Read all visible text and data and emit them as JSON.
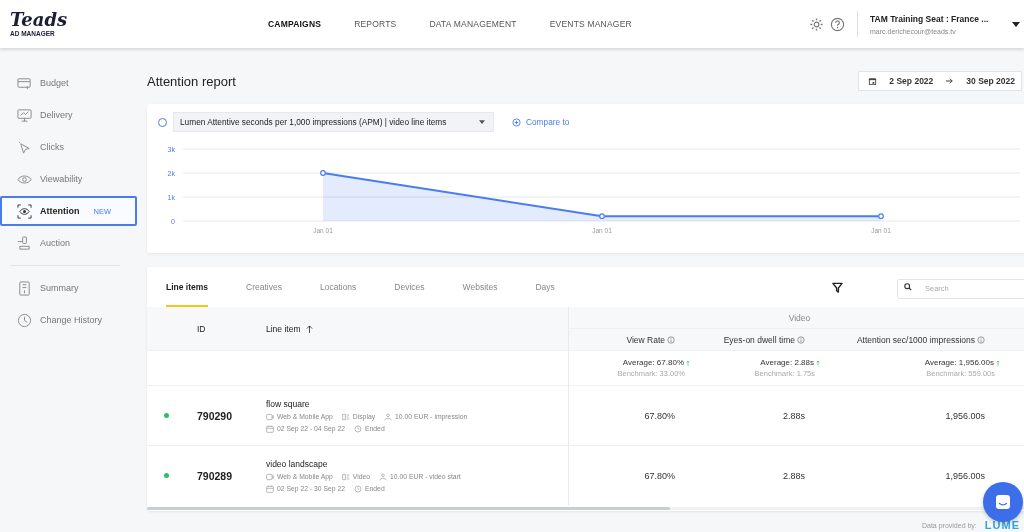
{
  "header": {
    "logo": "Teads",
    "logo_sub": "AD MANAGER",
    "nav": [
      {
        "label": "CAMPAIGNS",
        "selected": true
      },
      {
        "label": "REPORTS",
        "selected": false
      },
      {
        "label": "DATA MANAGEMENT",
        "selected": false
      },
      {
        "label": "EVENTS MANAGER",
        "selected": false
      }
    ],
    "account": {
      "name": "TAM Training Seat : France ...",
      "email": "marc.derichecour@teads.tv"
    }
  },
  "sidebar": {
    "items": [
      {
        "label": "Budget",
        "selected": false
      },
      {
        "label": "Delivery",
        "selected": false
      },
      {
        "label": "Clicks",
        "selected": false
      },
      {
        "label": "Viewability",
        "selected": false
      },
      {
        "label": "Attention",
        "badge": "NEW",
        "selected": true
      },
      {
        "label": "Auction",
        "selected": false
      }
    ],
    "secondary": [
      {
        "label": "Summary",
        "selected": false
      },
      {
        "label": "Change History",
        "selected": false
      }
    ]
  },
  "page": {
    "title": "Attention report",
    "date_from": "2 Sep 2022",
    "date_to": "30 Sep 2022"
  },
  "chart": {
    "series_selected": true,
    "metric": "Lumen Attentive seconds per 1,000 impressions (APM) | video line items",
    "compare": "Compare to",
    "chart_data": {
      "type": "area",
      "categories": [
        "Jan 01",
        "Jan 01",
        "Jan 01"
      ],
      "series": [
        {
          "color": "#4a7cf0",
          "values": [
            2000,
            200,
            200
          ]
        }
      ],
      "ylim": [
        0,
        3000
      ],
      "yticks": [
        {
          "value": 0,
          "label": "0"
        },
        {
          "value": 1000,
          "label": "1k"
        },
        {
          "value": 2000,
          "label": "2k"
        },
        {
          "value": 3000,
          "label": "3k"
        }
      ]
    }
  },
  "tabs": [
    {
      "label": "Line items",
      "selected": true
    },
    {
      "label": "Creatives",
      "selected": false
    },
    {
      "label": "Locations",
      "selected": false
    },
    {
      "label": "Devices",
      "selected": false
    },
    {
      "label": "Websites",
      "selected": false
    },
    {
      "label": "Days",
      "selected": false
    }
  ],
  "search": {
    "placeholder": "Search"
  },
  "table": {
    "group": "Video",
    "columns": [
      "ID",
      "Line item",
      "View Rate",
      "Eyes-on dwell time",
      "Attention sec/1000 impressions"
    ],
    "summary": [
      {
        "average": "Average: 67.80%",
        "benchmark": "Benchmark: 33.00%"
      },
      {
        "average": "Average: 2.88s",
        "benchmark": "Benchmark: 1.75s"
      },
      {
        "average": "Average: 1,956.00s",
        "benchmark": "Benchmark: 559.00s"
      }
    ],
    "rows": [
      {
        "color": "#2fbf5b",
        "id": "790290",
        "name": "flow square",
        "platform": "Web & Mobile App",
        "format": "Display",
        "price": "10.00 EUR - impression",
        "dates": "02 Sep 22 - 04 Sep 22",
        "status": "Ended",
        "values": [
          "67.80%",
          "2.88s",
          "1,956.00s"
        ]
      },
      {
        "color": "#2fbf5b",
        "id": "790289",
        "name": "video landscape",
        "platform": "Web & Mobile App",
        "format": "Video",
        "price": "10.00 EUR - video start",
        "dates": "02 Sep 22 - 30 Sep 22",
        "status": "Ended",
        "values": [
          "67.80%",
          "2.88s",
          "1,956.00s"
        ]
      }
    ]
  },
  "footer": {
    "provided": "Data provided by:",
    "logo": "LUME"
  }
}
